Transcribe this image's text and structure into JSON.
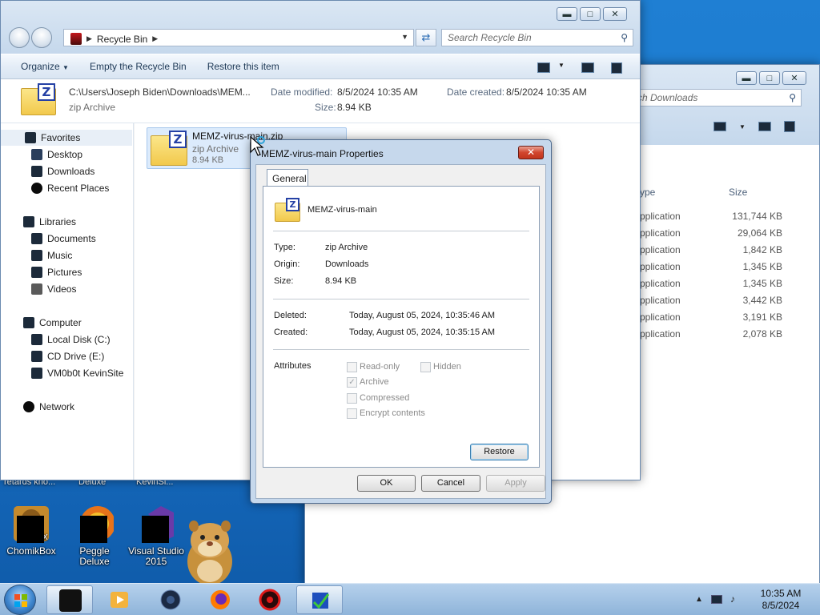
{
  "desktop": {
    "partial_labels": [
      "retards kno...",
      "Deluxe",
      "KevinSi..."
    ],
    "icons": [
      {
        "label": "ChomikBox",
        "icon": "chomikbox-icon"
      },
      {
        "label": "Peggle Deluxe",
        "icon": "peggle-icon"
      },
      {
        "label": "Visual Studio 2015",
        "icon": "visual-studio-icon"
      }
    ]
  },
  "bg_window": {
    "search_placeholder": "rch Downloads",
    "columns": {
      "type": "ype",
      "size": "Size"
    },
    "rows": [
      {
        "type": "pplication",
        "size": "131,744 KB"
      },
      {
        "type": "pplication",
        "size": "29,064 KB"
      },
      {
        "type": "pplication",
        "size": "1,842 KB"
      },
      {
        "type": "pplication",
        "size": "1,345 KB"
      },
      {
        "type": "pplication",
        "size": "1,345 KB"
      },
      {
        "type": "pplication",
        "size": "3,442 KB"
      },
      {
        "type": "pplication",
        "size": "3,191 KB"
      },
      {
        "type": "pplication",
        "size": "2,078 KB"
      }
    ]
  },
  "explorer": {
    "address": {
      "location": "Recycle Bin"
    },
    "search_placeholder": "Search Recycle Bin",
    "commands": {
      "organize": "Organize",
      "empty": "Empty the Recycle Bin",
      "restore": "Restore this item"
    },
    "details": {
      "path": "C:\\Users\\Joseph Biden\\Downloads\\MEM...",
      "type": "zip Archive",
      "modified_label": "Date modified:",
      "modified_value": "8/5/2024 10:35 AM",
      "created_label": "Date created:",
      "created_value": "8/5/2024 10:35 AM",
      "size_label": "Size:",
      "size_value": "8.94 KB"
    },
    "nav": {
      "favorites": "Favorites",
      "desktop": "Desktop",
      "downloads": "Downloads",
      "recent": "Recent Places",
      "libraries": "Libraries",
      "documents": "Documents",
      "music": "Music",
      "pictures": "Pictures",
      "videos": "Videos",
      "computer": "Computer",
      "local_disk": "Local Disk (C:)",
      "cd_drive": "CD Drive (E:)",
      "share": "VM0b0t KevinSite",
      "network": "Network"
    },
    "file": {
      "name": "MEMZ-virus-main.zip",
      "type": "zip Archive",
      "size": "8.94 KB"
    }
  },
  "properties": {
    "title": "MEMZ-virus-main Properties",
    "tab": "General",
    "name": "MEMZ-virus-main",
    "type_label": "Type:",
    "type_value": "zip Archive",
    "origin_label": "Origin:",
    "origin_value": "Downloads",
    "size_label": "Size:",
    "size_value": "8.94 KB",
    "deleted_label": "Deleted:",
    "deleted_value": "Today, August 05, 2024, 10:35:46 AM",
    "created_label": "Created:",
    "created_value": "Today, August 05, 2024, 10:35:15 AM",
    "attributes_label": "Attributes",
    "attr_readonly": "Read-only",
    "attr_hidden": "Hidden",
    "attr_archive": "Archive",
    "attr_compressed": "Compressed",
    "attr_encrypt": "Encrypt contents",
    "restore": "Restore",
    "ok": "OK",
    "cancel": "Cancel",
    "apply": "Apply"
  },
  "taskbar": {
    "time": "10:35 AM",
    "date": "8/5/2024"
  }
}
